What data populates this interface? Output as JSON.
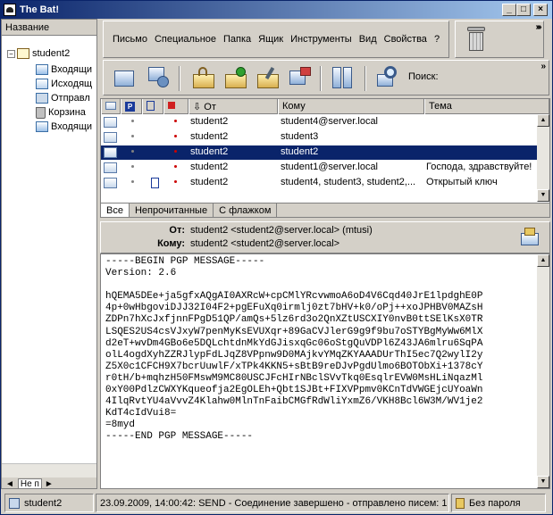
{
  "window": {
    "title": "The Bat!"
  },
  "tree": {
    "header": "Название",
    "account": "student2",
    "folders": [
      "Входящи",
      "Исходящ",
      "Отправл",
      "Корзина",
      "Входящи"
    ],
    "tab_label": "Не п"
  },
  "menu": {
    "items": [
      "Письмо",
      "Специальное",
      "Папка",
      "Ящик",
      "Инструменты",
      "Вид",
      "Свойства",
      "?"
    ]
  },
  "toolbar": {
    "search_label": "Поиск:"
  },
  "message_list": {
    "columns": {
      "from": "От",
      "to": "Кому",
      "subject": "Тема"
    },
    "rows": [
      {
        "from": "student2",
        "to": "student4@server.local",
        "subject": "",
        "selected": false
      },
      {
        "from": "student2",
        "to": "student3",
        "subject": "",
        "selected": false
      },
      {
        "from": "student2",
        "to": "student2",
        "subject": "",
        "selected": true
      },
      {
        "from": "student2",
        "to": "student1@server.local",
        "subject": "Господа, здравствуйте!",
        "selected": false
      },
      {
        "from": "student2",
        "to": "student4, student3, student2,...",
        "subject": "Открытый ключ",
        "selected": false
      }
    ],
    "tabs": [
      "Все",
      "Непрочитанные",
      "С флажком"
    ]
  },
  "viewer": {
    "from_label": "От:",
    "from_value": "student2 <student2@server.local>  (mtusi)",
    "to_label": "Кому:",
    "to_value": "student2 <student2@server.local>",
    "body": "-----BEGIN PGP MESSAGE-----\nVersion: 2.6\n\nhQEMA5DEe+ja5gfxAQgAI0AXRcW+cpCMlYRcvwmoA6oD4V6Cqd40JrE1lpdghE0P\n4p+0wHbgoviDJJ32I04F2+pgEFuXq0irmlj0zt7bHV+k0/oPj++xoJPHBV0MAZsH\nZDPn7hXcJxfjnnFPgD51QP/amQs+5lz6rd3o2QnXZtUSCXIY0nvB0ttSElKsX0TR\nLSQES2US4csVJxyW7penMyKsEVUXqr+89GaCVJlerG9g9f9bu7oSTYBgMyWw6MlX\nd2eT+wvDm4GBo6e5DQLchtdnMkYdGJisxqGc06oStgQuVDPl6Z43JA6mlru6SqPA\nolL4ogdXyhZZRJlypFdLJqZ8VPpnw9D0MAjkvYMqZKYAAADUrThI5ec7Q2wylI2y\nZ5X0c1CFCH9X7bcrUuwlF/xTPk4KKN5+sBtB9reDJvPgdUlmo6BOTObXi+1378cY\nr0tH/b+mqhzH50FMswM9MC80USCJFcHIrNBclSVvTkq0EsqlrEVW0MsHLiNqazMl\n0xY00PdlzCWXYKqueofja2EgOLEh+Qbt1SJBt+FIXVPpmv0KCnTdVWGEjcUYoaWn\n4IlqRvtYU4aVvvZ4Klahw0MlnTnFaibCMGfRdWliYxmZ6/VKH8Bcl6W3M/WV1je2\nKdT4cIdVui8=\n=8myd\n-----END PGP MESSAGE-----"
  },
  "status": {
    "account": "student2",
    "message": "23.09.2009, 14:00:42: SEND  - Соединение завершено - отправлено писем: 1",
    "password": "Без пароля"
  }
}
